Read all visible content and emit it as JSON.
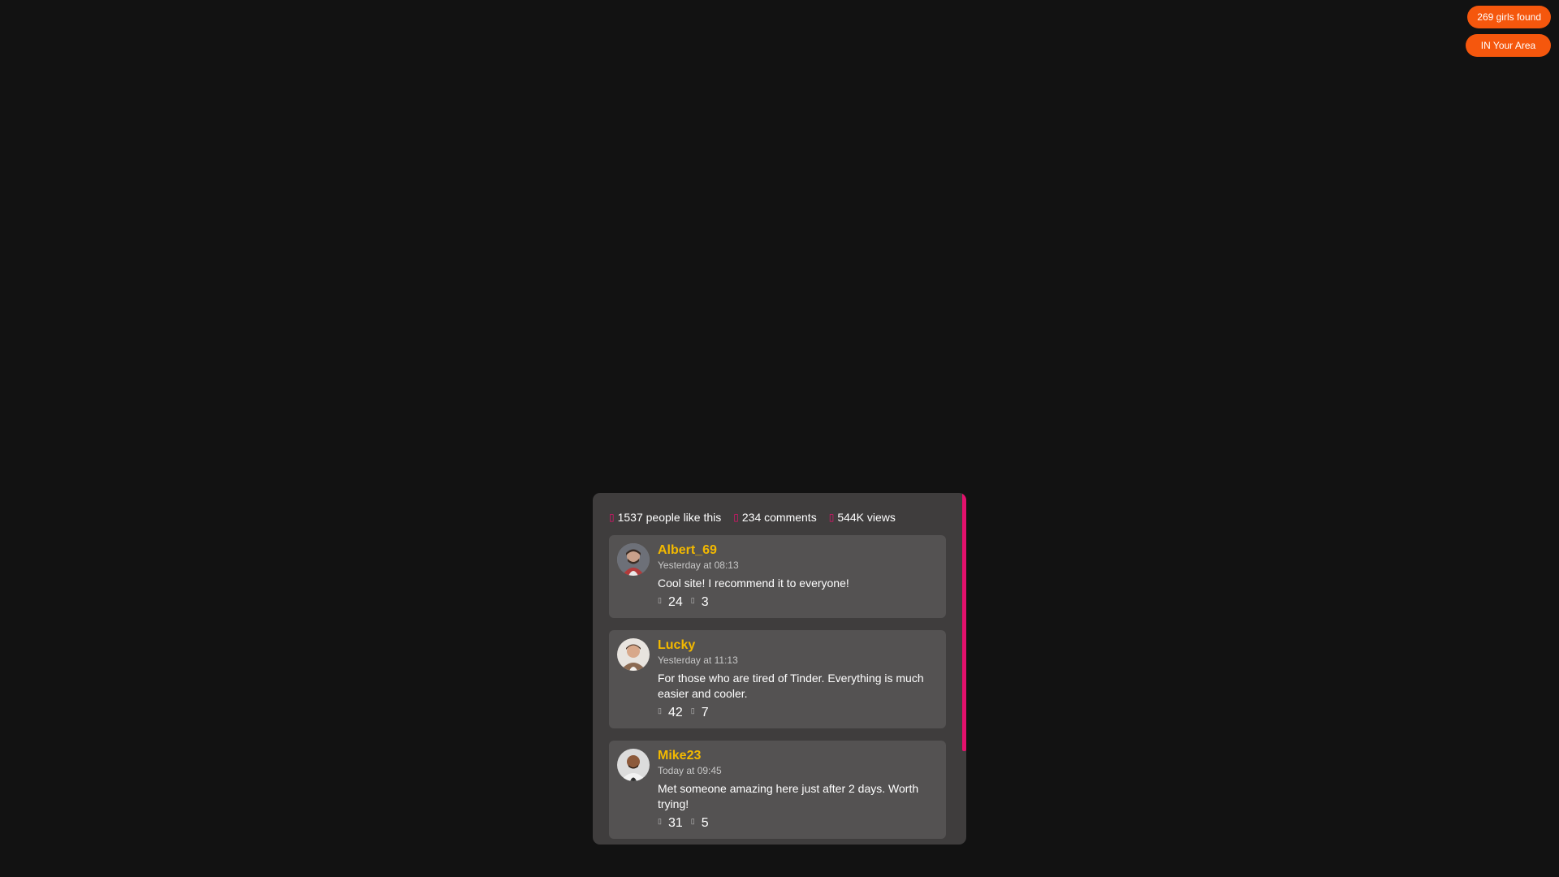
{
  "badges": {
    "found": "269 girls found",
    "area": "IN Your Area"
  },
  "colors": {
    "background": "#121212",
    "panel": "#3f3d3d",
    "card": "#545252",
    "accent_pink": "#e3116c",
    "accent_orange": "#f5570d",
    "username": "#f3b900"
  },
  "stats": {
    "likes": "1537 people like this",
    "comments": "234 comments",
    "views": "544K views",
    "icon": "heart-icon"
  },
  "comments": [
    {
      "user": "Albert_69",
      "time": "Yesterday at 08:13",
      "text": "Cool site! I recommend it to everyone!",
      "likes": "24",
      "dislikes": "3"
    },
    {
      "user": "Lucky",
      "time": "Yesterday at 11:13",
      "text": "For those who are tired of Tinder. Everything is much easier and cooler.",
      "likes": "42",
      "dislikes": "7"
    },
    {
      "user": "Mike23",
      "time": "Today at 09:45",
      "text": "Met someone amazing here just after 2 days. Worth trying!",
      "likes": "31",
      "dislikes": "5"
    }
  ]
}
